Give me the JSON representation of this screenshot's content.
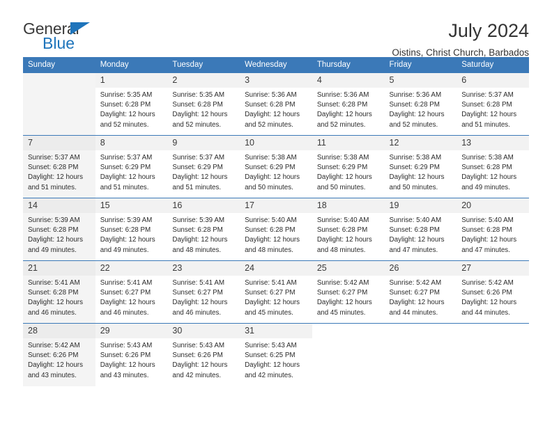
{
  "logo": {
    "word1": "General",
    "word2": "Blue",
    "triangle_color": "#1e74bb"
  },
  "header": {
    "title": "July 2024",
    "subtitle": "Oistins, Christ Church, Barbados",
    "accent_color": "#3b79b8"
  },
  "weekday_headers": [
    "Sunday",
    "Monday",
    "Tuesday",
    "Wednesday",
    "Thursday",
    "Friday",
    "Saturday"
  ],
  "labels": {
    "sunrise": "Sunrise:",
    "sunset": "Sunset:",
    "daylight": "Daylight:"
  },
  "weeks": [
    [
      {
        "day": "",
        "sunrise": "",
        "sunset": "",
        "daylight1": "",
        "daylight2": "",
        "empty": true
      },
      {
        "day": "1",
        "sunrise": "Sunrise: 5:35 AM",
        "sunset": "Sunset: 6:28 PM",
        "daylight1": "Daylight: 12 hours",
        "daylight2": "and 52 minutes."
      },
      {
        "day": "2",
        "sunrise": "Sunrise: 5:35 AM",
        "sunset": "Sunset: 6:28 PM",
        "daylight1": "Daylight: 12 hours",
        "daylight2": "and 52 minutes."
      },
      {
        "day": "3",
        "sunrise": "Sunrise: 5:36 AM",
        "sunset": "Sunset: 6:28 PM",
        "daylight1": "Daylight: 12 hours",
        "daylight2": "and 52 minutes."
      },
      {
        "day": "4",
        "sunrise": "Sunrise: 5:36 AM",
        "sunset": "Sunset: 6:28 PM",
        "daylight1": "Daylight: 12 hours",
        "daylight2": "and 52 minutes."
      },
      {
        "day": "5",
        "sunrise": "Sunrise: 5:36 AM",
        "sunset": "Sunset: 6:28 PM",
        "daylight1": "Daylight: 12 hours",
        "daylight2": "and 52 minutes."
      },
      {
        "day": "6",
        "sunrise": "Sunrise: 5:37 AM",
        "sunset": "Sunset: 6:28 PM",
        "daylight1": "Daylight: 12 hours",
        "daylight2": "and 51 minutes."
      }
    ],
    [
      {
        "day": "7",
        "sunrise": "Sunrise: 5:37 AM",
        "sunset": "Sunset: 6:28 PM",
        "daylight1": "Daylight: 12 hours",
        "daylight2": "and 51 minutes."
      },
      {
        "day": "8",
        "sunrise": "Sunrise: 5:37 AM",
        "sunset": "Sunset: 6:29 PM",
        "daylight1": "Daylight: 12 hours",
        "daylight2": "and 51 minutes."
      },
      {
        "day": "9",
        "sunrise": "Sunrise: 5:37 AM",
        "sunset": "Sunset: 6:29 PM",
        "daylight1": "Daylight: 12 hours",
        "daylight2": "and 51 minutes."
      },
      {
        "day": "10",
        "sunrise": "Sunrise: 5:38 AM",
        "sunset": "Sunset: 6:29 PM",
        "daylight1": "Daylight: 12 hours",
        "daylight2": "and 50 minutes."
      },
      {
        "day": "11",
        "sunrise": "Sunrise: 5:38 AM",
        "sunset": "Sunset: 6:29 PM",
        "daylight1": "Daylight: 12 hours",
        "daylight2": "and 50 minutes."
      },
      {
        "day": "12",
        "sunrise": "Sunrise: 5:38 AM",
        "sunset": "Sunset: 6:29 PM",
        "daylight1": "Daylight: 12 hours",
        "daylight2": "and 50 minutes."
      },
      {
        "day": "13",
        "sunrise": "Sunrise: 5:38 AM",
        "sunset": "Sunset: 6:28 PM",
        "daylight1": "Daylight: 12 hours",
        "daylight2": "and 49 minutes."
      }
    ],
    [
      {
        "day": "14",
        "sunrise": "Sunrise: 5:39 AM",
        "sunset": "Sunset: 6:28 PM",
        "daylight1": "Daylight: 12 hours",
        "daylight2": "and 49 minutes."
      },
      {
        "day": "15",
        "sunrise": "Sunrise: 5:39 AM",
        "sunset": "Sunset: 6:28 PM",
        "daylight1": "Daylight: 12 hours",
        "daylight2": "and 49 minutes."
      },
      {
        "day": "16",
        "sunrise": "Sunrise: 5:39 AM",
        "sunset": "Sunset: 6:28 PM",
        "daylight1": "Daylight: 12 hours",
        "daylight2": "and 48 minutes."
      },
      {
        "day": "17",
        "sunrise": "Sunrise: 5:40 AM",
        "sunset": "Sunset: 6:28 PM",
        "daylight1": "Daylight: 12 hours",
        "daylight2": "and 48 minutes."
      },
      {
        "day": "18",
        "sunrise": "Sunrise: 5:40 AM",
        "sunset": "Sunset: 6:28 PM",
        "daylight1": "Daylight: 12 hours",
        "daylight2": "and 48 minutes."
      },
      {
        "day": "19",
        "sunrise": "Sunrise: 5:40 AM",
        "sunset": "Sunset: 6:28 PM",
        "daylight1": "Daylight: 12 hours",
        "daylight2": "and 47 minutes."
      },
      {
        "day": "20",
        "sunrise": "Sunrise: 5:40 AM",
        "sunset": "Sunset: 6:28 PM",
        "daylight1": "Daylight: 12 hours",
        "daylight2": "and 47 minutes."
      }
    ],
    [
      {
        "day": "21",
        "sunrise": "Sunrise: 5:41 AM",
        "sunset": "Sunset: 6:28 PM",
        "daylight1": "Daylight: 12 hours",
        "daylight2": "and 46 minutes."
      },
      {
        "day": "22",
        "sunrise": "Sunrise: 5:41 AM",
        "sunset": "Sunset: 6:27 PM",
        "daylight1": "Daylight: 12 hours",
        "daylight2": "and 46 minutes."
      },
      {
        "day": "23",
        "sunrise": "Sunrise: 5:41 AM",
        "sunset": "Sunset: 6:27 PM",
        "daylight1": "Daylight: 12 hours",
        "daylight2": "and 46 minutes."
      },
      {
        "day": "24",
        "sunrise": "Sunrise: 5:41 AM",
        "sunset": "Sunset: 6:27 PM",
        "daylight1": "Daylight: 12 hours",
        "daylight2": "and 45 minutes."
      },
      {
        "day": "25",
        "sunrise": "Sunrise: 5:42 AM",
        "sunset": "Sunset: 6:27 PM",
        "daylight1": "Daylight: 12 hours",
        "daylight2": "and 45 minutes."
      },
      {
        "day": "26",
        "sunrise": "Sunrise: 5:42 AM",
        "sunset": "Sunset: 6:27 PM",
        "daylight1": "Daylight: 12 hours",
        "daylight2": "and 44 minutes."
      },
      {
        "day": "27",
        "sunrise": "Sunrise: 5:42 AM",
        "sunset": "Sunset: 6:26 PM",
        "daylight1": "Daylight: 12 hours",
        "daylight2": "and 44 minutes."
      }
    ],
    [
      {
        "day": "28",
        "sunrise": "Sunrise: 5:42 AM",
        "sunset": "Sunset: 6:26 PM",
        "daylight1": "Daylight: 12 hours",
        "daylight2": "and 43 minutes."
      },
      {
        "day": "29",
        "sunrise": "Sunrise: 5:43 AM",
        "sunset": "Sunset: 6:26 PM",
        "daylight1": "Daylight: 12 hours",
        "daylight2": "and 43 minutes."
      },
      {
        "day": "30",
        "sunrise": "Sunrise: 5:43 AM",
        "sunset": "Sunset: 6:26 PM",
        "daylight1": "Daylight: 12 hours",
        "daylight2": "and 42 minutes."
      },
      {
        "day": "31",
        "sunrise": "Sunrise: 5:43 AM",
        "sunset": "Sunset: 6:25 PM",
        "daylight1": "Daylight: 12 hours",
        "daylight2": "and 42 minutes."
      },
      {
        "day": "",
        "sunrise": "",
        "sunset": "",
        "daylight1": "",
        "daylight2": "",
        "empty": true
      },
      {
        "day": "",
        "sunrise": "",
        "sunset": "",
        "daylight1": "",
        "daylight2": "",
        "empty": true
      },
      {
        "day": "",
        "sunrise": "",
        "sunset": "",
        "daylight1": "",
        "daylight2": "",
        "empty": true
      }
    ]
  ]
}
